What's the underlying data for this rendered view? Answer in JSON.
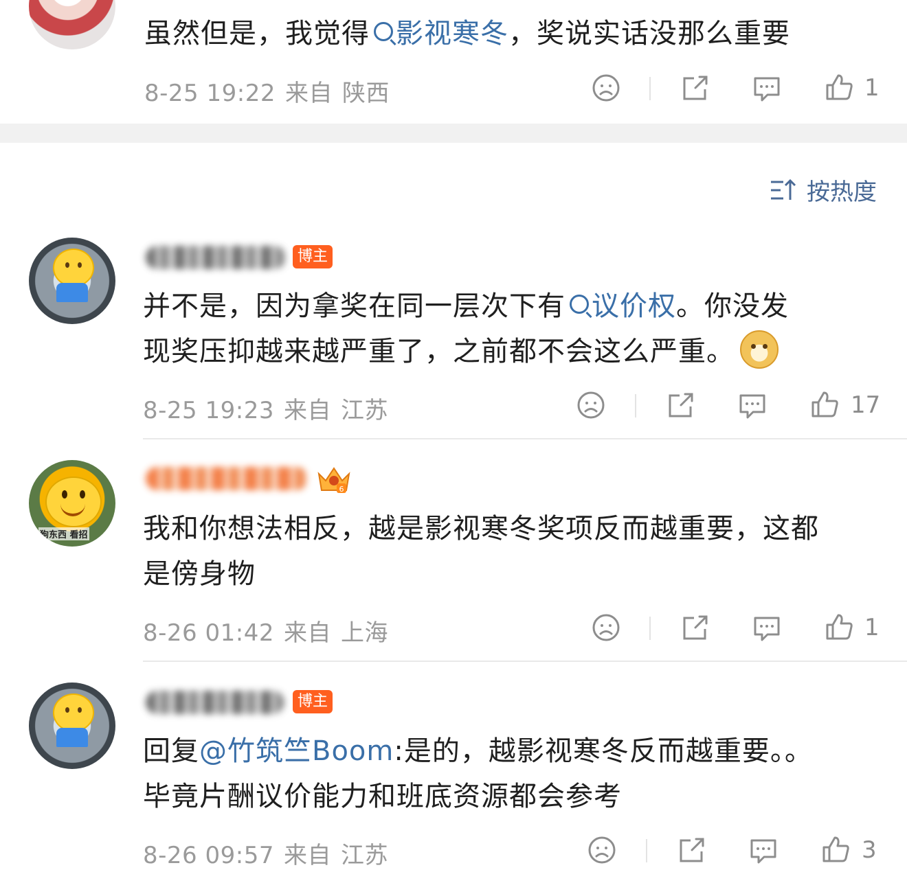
{
  "sort": {
    "label": "按热度"
  },
  "comments": [
    {
      "id": "c0",
      "text_before": "虽然但是，我觉得",
      "link": "影视寒冬",
      "text_after": "，奖说实话没那么重要",
      "date": "8-25 19:22",
      "from": "来自",
      "location": "陕西",
      "likes": "1"
    },
    {
      "id": "c1",
      "badge": "博主",
      "line1_before": "并不是，因为拿奖在同一层次下有",
      "link": "议价权",
      "line1_after": "。你没发",
      "line2": "现奖压抑越来越严重了，之前都不会这么严重。",
      "date": "8-25 19:23",
      "from": "来自",
      "location": "江苏",
      "likes": "17"
    },
    {
      "id": "c2",
      "avatar_caption": "狗东西 看招",
      "line1": "我和你想法相反，越是影视寒冬奖项反而越重要，这都",
      "line2": "是傍身物",
      "date": "8-26 01:42",
      "from": "来自",
      "location": "上海",
      "likes": "1"
    },
    {
      "id": "c3",
      "badge": "博主",
      "reply_prefix": "回复",
      "mention": "@竹筑竺Boom",
      "line1_after": ":是的，越影视寒冬反而越重要。。",
      "line2": "毕竟片酬议价能力和班底资源都会参考",
      "date": "8-26 09:57",
      "from": "来自",
      "location": "江苏",
      "likes": "3"
    }
  ],
  "icons": [
    "sad-face-icon",
    "share-icon",
    "comment-icon",
    "thumb-up-icon",
    "sort-icon",
    "search-icon",
    "doge-emoji-icon",
    "crown-badge-icon"
  ],
  "colors": {
    "link": "#3a6fa8",
    "badge": "#ff5f1f",
    "meta": "#9a9a9a",
    "sort": "#4a6a96"
  }
}
